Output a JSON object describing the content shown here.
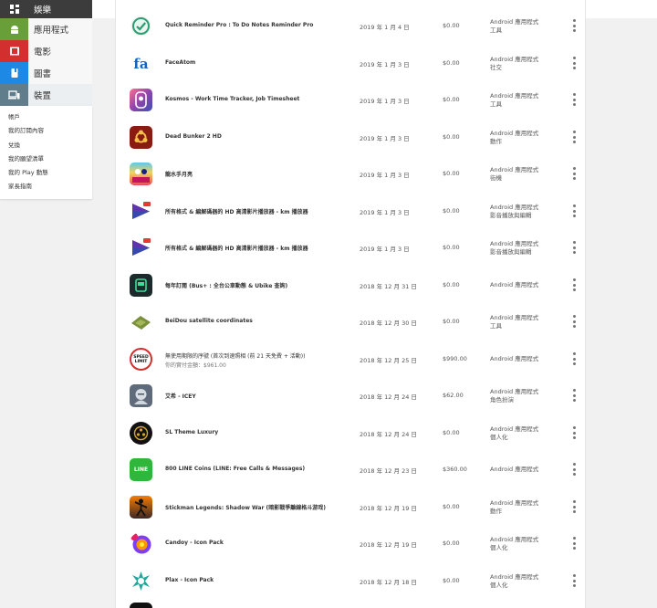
{
  "sidebar": {
    "categories": [
      {
        "label": "娛樂",
        "icon": "grid-icon"
      },
      {
        "label": "應用程式",
        "icon": "android-icon"
      },
      {
        "label": "電影",
        "icon": "film-icon"
      },
      {
        "label": "圖書",
        "icon": "book-icon"
      },
      {
        "label": "裝置",
        "icon": "devices-icon"
      }
    ],
    "links": [
      "帳戶",
      "我的訂閱內容",
      "兌換",
      "我的願望清單",
      "我的 Play 動態",
      "家長指南"
    ]
  },
  "colors": {
    "apps_accent": "#689f38",
    "movies_accent": "#d32f2f",
    "books_accent": "#1e88e5",
    "devices_accent": "#607d8b"
  },
  "orders": [
    {
      "title": "Quick Reminder Pro : To Do Notes Reminder Pro",
      "date": "2019 年 1 月 4 日",
      "price": "$0.00",
      "type1": "Android 應用程式",
      "type2": "工具",
      "icon": "check-badge-icon"
    },
    {
      "title": "FaceAtom",
      "date": "2019 年 1 月 3 日",
      "price": "$0.00",
      "type1": "Android 應用程式",
      "type2": "社交",
      "icon": "fa-icon",
      "icon_text": "fa"
    },
    {
      "title": "Kosmos - Work Time Tracker, Job Timesheet",
      "date": "2019 年 1 月 3 日",
      "price": "$0.00",
      "type1": "Android 應用程式",
      "type2": "工具",
      "icon": "kosmos-icon"
    },
    {
      "title": "Dead Bunker 2 HD",
      "date": "2019 年 1 月 3 日",
      "price": "$0.00",
      "type1": "Android 應用程式",
      "type2": "動作",
      "icon": "biohazard-icon"
    },
    {
      "title": "龍水手月亮",
      "date": "2019 年 1 月 3 日",
      "price": "$0.00",
      "type1": "Android 應用程式",
      "type2": "街機",
      "icon": "game-art-icon"
    },
    {
      "title": "所有格式 & 編解碼器的 HD 高清影片播放器 - km 播放器",
      "date": "2019 年 1 月 3 日",
      "price": "$0.00",
      "type1": "Android 應用程式",
      "type2": "影音播放與編輯",
      "icon": "km-player-icon"
    },
    {
      "title": "所有格式 & 編解碼器的 HD 高清影片播放器 - km 播放器",
      "date": "2019 年 1 月 3 日",
      "price": "$0.00",
      "type1": "Android 應用程式",
      "type2": "影音播放與編輯",
      "icon": "km-player-icon"
    },
    {
      "title": "每年訂閱 (Bus+ : 全台公車動態 & Ubike 查詢)",
      "date": "2018 年 12 月 31 日",
      "price": "$0.00",
      "type1": "Android 應用程式",
      "type2": "",
      "icon": "bus-icon"
    },
    {
      "title": "BeiDou satellite coordinates",
      "date": "2018 年 12 月 30 日",
      "price": "$0.00",
      "type1": "Android 應用程式",
      "type2": "工具",
      "icon": "satellite-map-icon"
    },
    {
      "title": "無使用期限的序號 (首次到速照相 (前 21 天免費 + 活動))",
      "subtitle": "你的實付金額：$961.00",
      "date": "2018 年 12 月 25 日",
      "price": "$990.00",
      "type1": "Android 應用程式",
      "type2": "",
      "icon": "speed-limit-icon",
      "icon_text": "SPEED LIMIT"
    },
    {
      "title": "艾希 - ICEY",
      "date": "2018 年 12 月 24 日",
      "price": "$62.00",
      "type1": "Android 應用程式",
      "type2": "角色扮演",
      "icon": "icey-icon"
    },
    {
      "title": "SL Theme Luxury",
      "date": "2018 年 12 月 24 日",
      "price": "$0.00",
      "type1": "Android 應用程式",
      "type2": "個人化",
      "icon": "luxury-theme-icon"
    },
    {
      "title": "800 LINE Coins (LINE: Free Calls & Messages)",
      "date": "2018 年 12 月 23 日",
      "price": "$360.00",
      "type1": "Android 應用程式",
      "type2": "",
      "icon": "line-icon",
      "icon_text": "LINE"
    },
    {
      "title": "Stickman Legends: Shadow War (暗影戰爭離線格斗游戏)",
      "date": "2018 年 12 月 19 日",
      "price": "$0.00",
      "type1": "Android 應用程式",
      "type2": "動作",
      "icon": "stickman-icon"
    },
    {
      "title": "Candoy - Icon Pack",
      "date": "2018 年 12 月 19 日",
      "price": "$0.00",
      "type1": "Android 應用程式",
      "type2": "個人化",
      "icon": "candoy-icon"
    },
    {
      "title": "Plax - Icon Pack",
      "date": "2018 年 12 月 18 日",
      "price": "$0.00",
      "type1": "Android 應用程式",
      "type2": "個人化",
      "icon": "plax-icon"
    }
  ]
}
